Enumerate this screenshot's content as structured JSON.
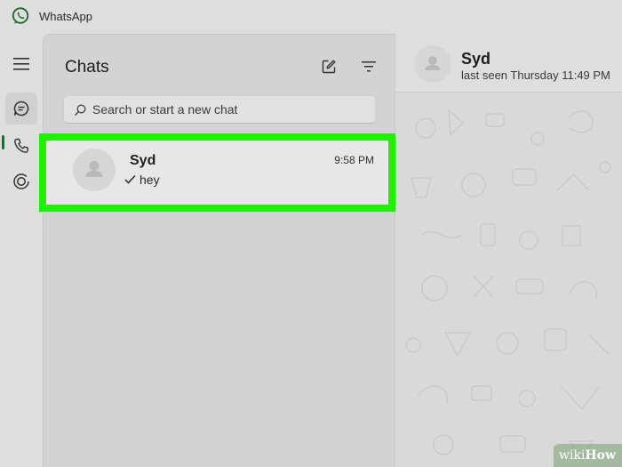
{
  "app": {
    "title": "WhatsApp"
  },
  "sidebar": {
    "items": [
      "menu-icon",
      "chats-icon",
      "calls-icon",
      "status-icon"
    ],
    "active": "chats-icon"
  },
  "chat_list": {
    "title": "Chats",
    "search": {
      "placeholder": "Search or start a new chat",
      "value": ""
    },
    "chats": [
      {
        "name": "Syd",
        "time": "9:58 PM",
        "preview": "hey",
        "status_icon": "single-check-icon",
        "highlighted": true
      }
    ]
  },
  "chat_header": {
    "name": "Syd",
    "status": "last seen Thursday 11:49 PM"
  },
  "watermark": {
    "prefix": "wiki",
    "suffix": "How"
  },
  "colors": {
    "highlight": "#22ee00",
    "brand": "#1c6b2e"
  }
}
